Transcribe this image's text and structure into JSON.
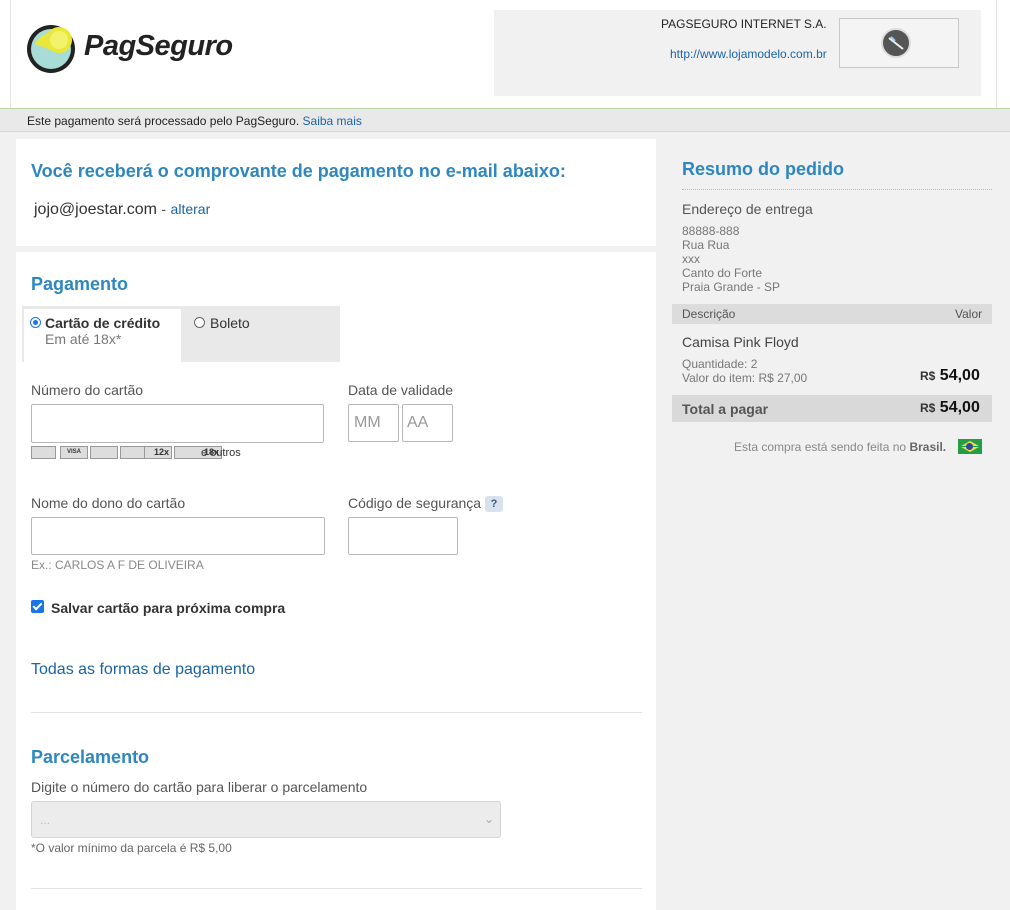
{
  "header": {
    "logo_text": "PagSeguro",
    "store_name": "PAGSEGURO INTERNET S.A.",
    "store_url": "http://www.lojamodelo.com.br"
  },
  "notice": {
    "text": "Este pagamento será processado pelo PagSeguro.",
    "link": "Saiba mais"
  },
  "email_section": {
    "title": "Você receberá o comprovante de pagamento no e-mail abaixo:",
    "email": "jojo@joestar.com",
    "separator": "-",
    "change_link": "alterar"
  },
  "payment": {
    "title": "Pagamento",
    "tabs": [
      {
        "label": "Cartão de crédito",
        "sub": "Em até 18x*",
        "selected": true
      },
      {
        "label": "Boleto",
        "selected": false
      }
    ],
    "card_number_label": "Número do cartão",
    "expiry_label": "Data de validade",
    "expiry_month_placeholder": "MM",
    "expiry_year_placeholder": "AA",
    "card_brands": [
      "mastercard-icon",
      "visa-icon",
      "amex-icon",
      "diners-icon",
      "elo-icon",
      "hipercard-icon"
    ],
    "brand_badges": [
      "12x",
      "18x"
    ],
    "brands_others": "e outros",
    "holder_label": "Nome do dono do cartão",
    "holder_hint": "Ex.: CARLOS A F DE OLIVEIRA",
    "cvv_label": "Código de segurança",
    "cvv_help": "?",
    "save_card_label": "Salvar cartão para próxima compra",
    "save_card_checked": true,
    "all_methods_link": "Todas as formas de pagamento"
  },
  "installments": {
    "title": "Parcelamento",
    "help": "Digite o número do cartão para liberar o parcelamento",
    "select_value": "...",
    "min_note": "*O valor mínimo da parcela é R$ 5,00"
  },
  "summary": {
    "title": "Resumo do pedido",
    "address_title": "Endereço de entrega",
    "address_lines": [
      "88888-888",
      "Rua Rua",
      "xxx",
      "Canto do Forte",
      "Praia Grande - SP"
    ],
    "col_desc": "Descrição",
    "col_value": "Valor",
    "item_name": "Camisa Pink Floyd",
    "item_qty": "Quantidade: 2",
    "item_unit": "Valor do item: R$ 27,00",
    "currency": "R$",
    "item_total": "54,00",
    "total_label": "Total a pagar",
    "total_value": "54,00",
    "country_note_prefix": "Esta compra está sendo feita no",
    "country": "Brasil.",
    "flag_icon": "brazil-flag-icon"
  },
  "colors": {
    "accent_blue": "#2e87c0",
    "link_blue": "#1a64a8",
    "panel_gray": "#f1f1f1"
  }
}
